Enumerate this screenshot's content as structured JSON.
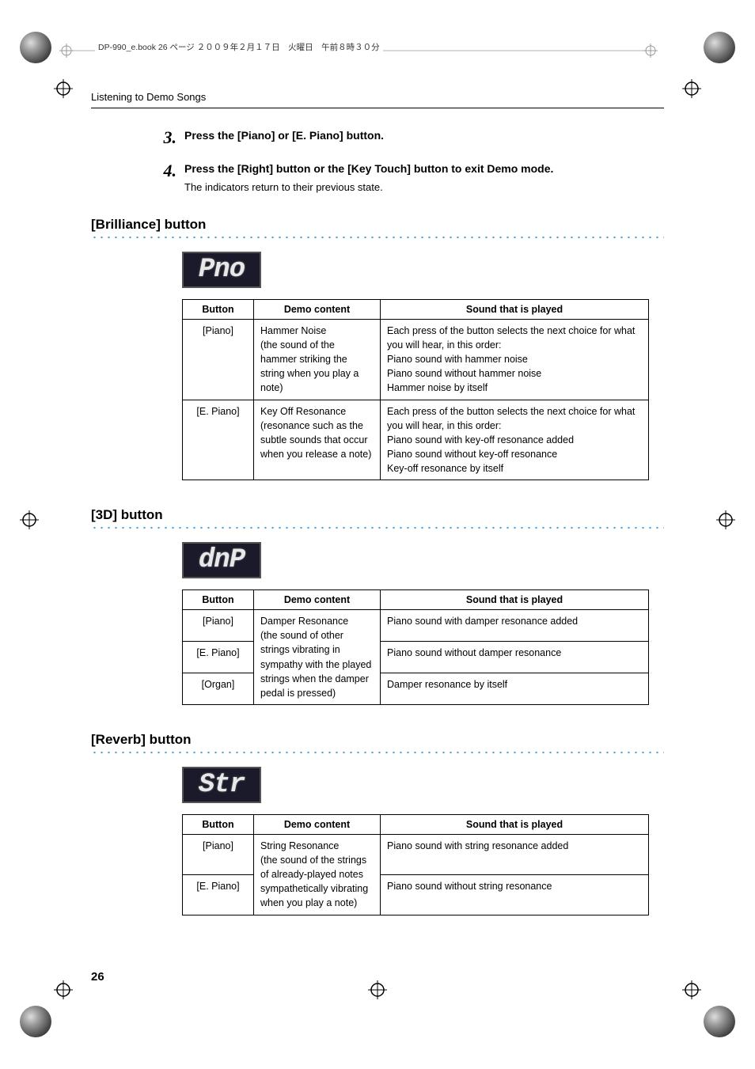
{
  "header_meta": "DP-990_e.book  26 ページ  ２００９年２月１７日　火曜日　午前８時３０分",
  "running_head": "Listening to Demo Songs",
  "steps": [
    {
      "num": "3.",
      "title": "Press the [Piano] or [E. Piano] button.",
      "sub": ""
    },
    {
      "num": "4.",
      "title": "Press the [Right] button or the [Key Touch] button to exit Demo mode.",
      "sub": "The indicators return to their previous state."
    }
  ],
  "sections": [
    {
      "title": "[Brilliance] button",
      "lcd": "Pno",
      "headers": [
        "Button",
        "Demo content",
        "Sound that is played"
      ],
      "rows": [
        {
          "button": "[Piano]",
          "content": "Hammer Noise\n(the sound of the hammer striking the string when you play a note)",
          "sound": "Each press of the button selects the next choice for what you will hear, in this order:\nPiano sound with hammer noise\nPiano sound without hammer noise\nHammer noise by itself"
        },
        {
          "button": "[E. Piano]",
          "content": "Key Off Resonance\n(resonance such as the subtle sounds that occur when you release a note)",
          "sound": "Each press of the button selects the next choice for what you will hear, in this order:\nPiano sound with key-off resonance added\nPiano sound without key-off resonance\nKey-off resonance by itself"
        }
      ]
    },
    {
      "title": "[3D] button",
      "lcd": "dnP",
      "headers": [
        "Button",
        "Demo content",
        "Sound that is played"
      ],
      "merged_content": "Damper Resonance\n(the sound of other strings vibrating in sympathy with the played strings when the damper pedal is pressed)",
      "rows": [
        {
          "button": "[Piano]",
          "sound": "Piano sound with damper resonance added"
        },
        {
          "button": "[E. Piano]",
          "sound": "Piano sound without damper resonance"
        },
        {
          "button": "[Organ]",
          "sound": "Damper resonance by itself"
        }
      ]
    },
    {
      "title": "[Reverb] button",
      "lcd": "Str",
      "headers": [
        "Button",
        "Demo content",
        "Sound that is played"
      ],
      "merged_content": "String Resonance\n(the sound of the strings of already-played notes sympathetically vibrating when you play a note)",
      "rows": [
        {
          "button": "[Piano]",
          "sound": "Piano sound with string resonance added"
        },
        {
          "button": "[E. Piano]",
          "sound": "Piano sound without string resonance"
        }
      ]
    }
  ],
  "page_number": "26"
}
